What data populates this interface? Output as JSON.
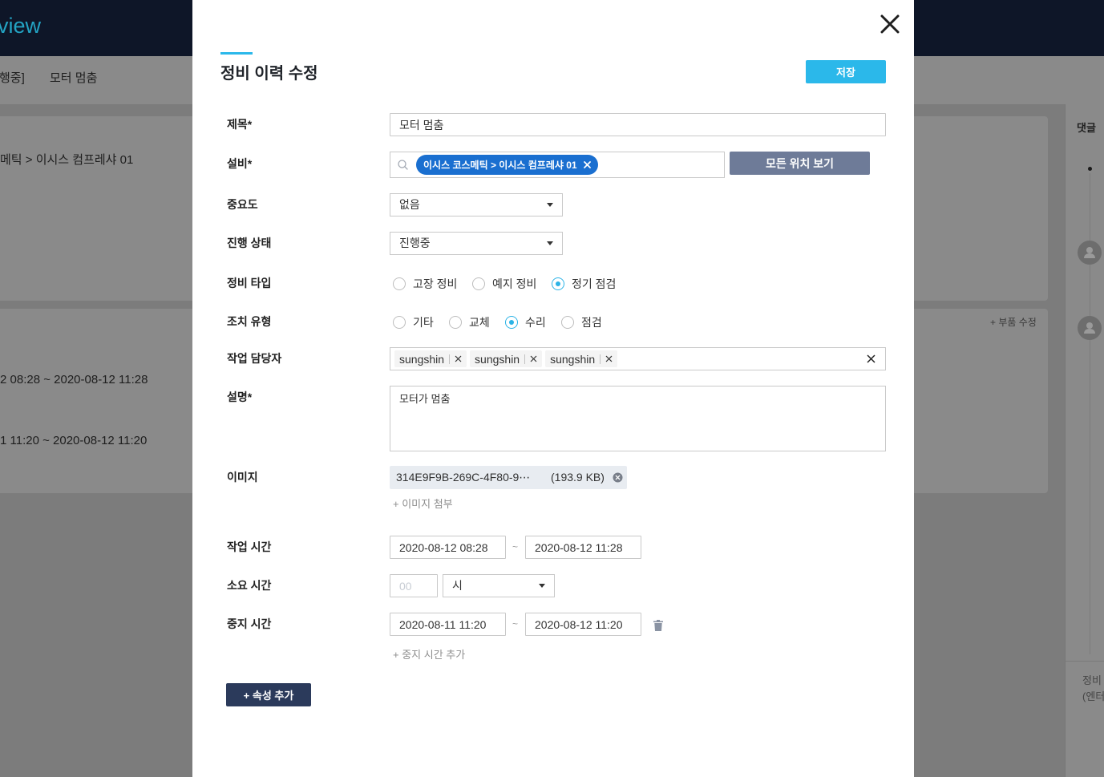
{
  "theme": {
    "accent": "#2bb8ea",
    "chip_blue": "#1a6fd0",
    "slate_button": "#6e7b98",
    "navy_button": "#2b3a5b",
    "radio_checked": "#2bb3e6"
  },
  "background": {
    "brand_fragment": "view",
    "status_fragment": "행중]",
    "page_title": "모터 멈춤",
    "location_fragment": "메틱 > 이시스 컴프레샤 01",
    "work_time_fragment": "2 08:28 ~ 2020-08-12 11:28",
    "stop_time_fragment": "1 11:20 ~ 2020-08-12 11:20",
    "parts_edit_link": "+ 부품 수정",
    "comments_tab": "댓글",
    "comment_hint_line1": "정비",
    "comment_hint_line2": "(엔터"
  },
  "modal": {
    "title": "정비 이력 수정",
    "save_label": "저장",
    "fields": {
      "title": {
        "label": "제목*",
        "value": "모터 멈춤"
      },
      "equipment": {
        "label": "설비*",
        "selected_chip": "이시스 코스메틱 > 이시스 컴프레샤 01",
        "view_all_label": "모든 위치 보기"
      },
      "priority": {
        "label": "중요도",
        "value": "없음"
      },
      "status": {
        "label": "진행 상태",
        "value": "진행중"
      },
      "maintenance_type": {
        "label": "정비 타입",
        "options": [
          {
            "label": "고장 정비",
            "checked": false
          },
          {
            "label": "예지 정비",
            "checked": false
          },
          {
            "label": "정기 점검",
            "checked": true
          }
        ]
      },
      "action_type": {
        "label": "조치 유형",
        "options": [
          {
            "label": "기타",
            "checked": false
          },
          {
            "label": "교체",
            "checked": false
          },
          {
            "label": "수리",
            "checked": true
          },
          {
            "label": "점검",
            "checked": false
          }
        ]
      },
      "assignees": {
        "label": "작업 담당자",
        "tags": [
          "sungshin",
          "sungshin",
          "sungshin"
        ]
      },
      "description": {
        "label": "설명*",
        "value": "모터가 멈춤"
      },
      "image": {
        "label": "이미지",
        "file_name": "314E9F9B-269C-4F80-9⋯",
        "file_size": "(193.9 KB)",
        "attach_label": "+ 이미지 첨부"
      },
      "work_time": {
        "label": "작업 시간",
        "start": "2020-08-12 08:28",
        "separator": "~",
        "end": "2020-08-12 11:28"
      },
      "duration": {
        "label": "소요 시간",
        "hours_placeholder": "00",
        "unit": "시"
      },
      "stop_time": {
        "label": "중지 시간",
        "start": "2020-08-11 11:20",
        "separator": "~",
        "end": "2020-08-12 11:20",
        "add_label": "+ 중지 시간 추가"
      }
    },
    "add_attribute_label": "+ 속성 추가"
  }
}
